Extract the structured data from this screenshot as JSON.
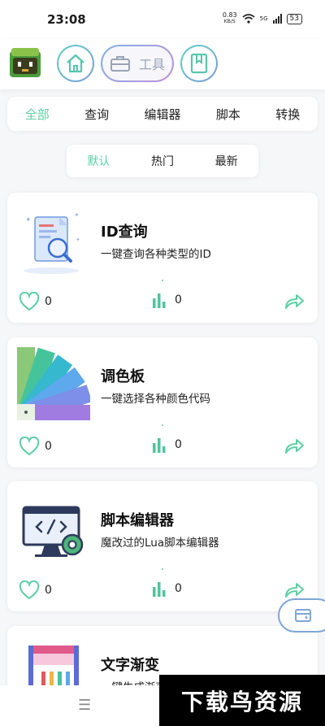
{
  "status": {
    "time": "23:08",
    "speed_value": "0.83",
    "speed_unit": "KB/S",
    "net": "5G",
    "battery": "53"
  },
  "header": {
    "tool_label": "工具"
  },
  "categories": [
    {
      "label": "全部",
      "active": true
    },
    {
      "label": "查询",
      "active": false
    },
    {
      "label": "编辑器",
      "active": false
    },
    {
      "label": "脚本",
      "active": false
    },
    {
      "label": "转换",
      "active": false
    }
  ],
  "sort": [
    {
      "label": "默认",
      "active": true
    },
    {
      "label": "热门",
      "active": false
    },
    {
      "label": "最新",
      "active": false
    }
  ],
  "cards": [
    {
      "title": "ID查询",
      "desc": "一键查询各种类型的ID",
      "likes": "0",
      "views": "0",
      "icon": "id-search-icon"
    },
    {
      "title": "调色板",
      "desc": "一键选择各种颜色代码",
      "likes": "0",
      "views": "0",
      "icon": "palette-icon"
    },
    {
      "title": "脚本编辑器",
      "desc": "魔改过的Lua脚本编辑器",
      "likes": "0",
      "views": "0",
      "icon": "code-editor-icon"
    },
    {
      "title": "文字渐变",
      "desc": "一键生成渐变色文字",
      "icon": "text-gradient-icon"
    }
  ],
  "watermark": "下载鸟资源",
  "colors": {
    "accent": "#5ccfa5",
    "stat": "#4fc59b"
  }
}
